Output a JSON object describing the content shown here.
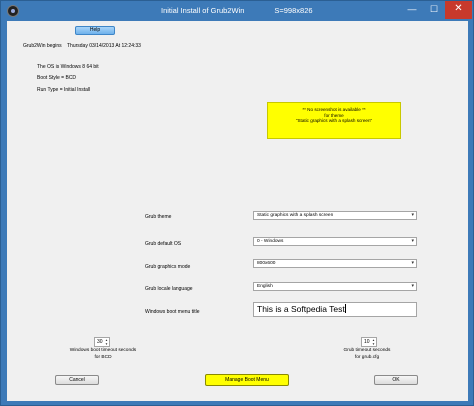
{
  "window": {
    "title": "Initial Install of Grub2Win",
    "size_label": "S=998x826",
    "controls": {
      "minimize": "—",
      "maximize": "☐",
      "close": "✕"
    }
  },
  "header": {
    "help_label": "Help",
    "begins_label": "Grub2Win begins",
    "begins_time": "Thursday 03/14/2013 At 12:24:33"
  },
  "info": {
    "os": "The OS is Windows 8  64 bit",
    "boot_style": "Boot Style = BCD",
    "run_type": "Run Type = Initial Install"
  },
  "splash": {
    "line1": "** No screenshot is available **",
    "line2": "for theme",
    "line3": "\"Static graphics with a splash screen\""
  },
  "settings": {
    "theme_label": "Grub theme",
    "theme_value": "Static graphics with a splash screen",
    "default_os_label": "Grub default OS",
    "default_os_value": "0  -  Windows",
    "graphics_mode_label": "Grub graphics mode",
    "graphics_mode_value": "800x600",
    "locale_label": "Grub locale language",
    "locale_value": "English",
    "boot_menu_title_label": "Windows boot menu title",
    "boot_menu_title_value": "This is a Softpedia Test"
  },
  "timeouts": {
    "windows_value": "30",
    "windows_label_1": "Windows boot timeout seconds",
    "windows_label_2": "for BCD",
    "grub_value": "10",
    "grub_label_1": "Grub timeout seconds",
    "grub_label_2": "for grub.cfg"
  },
  "footer": {
    "cancel_label": "Cancel",
    "manage_label": "Manage Boot Menu",
    "ok_label": "OK"
  },
  "colors": {
    "titlebar": "#3d7ab8",
    "highlight": "#ffff00",
    "close_button": "#c7392c"
  }
}
